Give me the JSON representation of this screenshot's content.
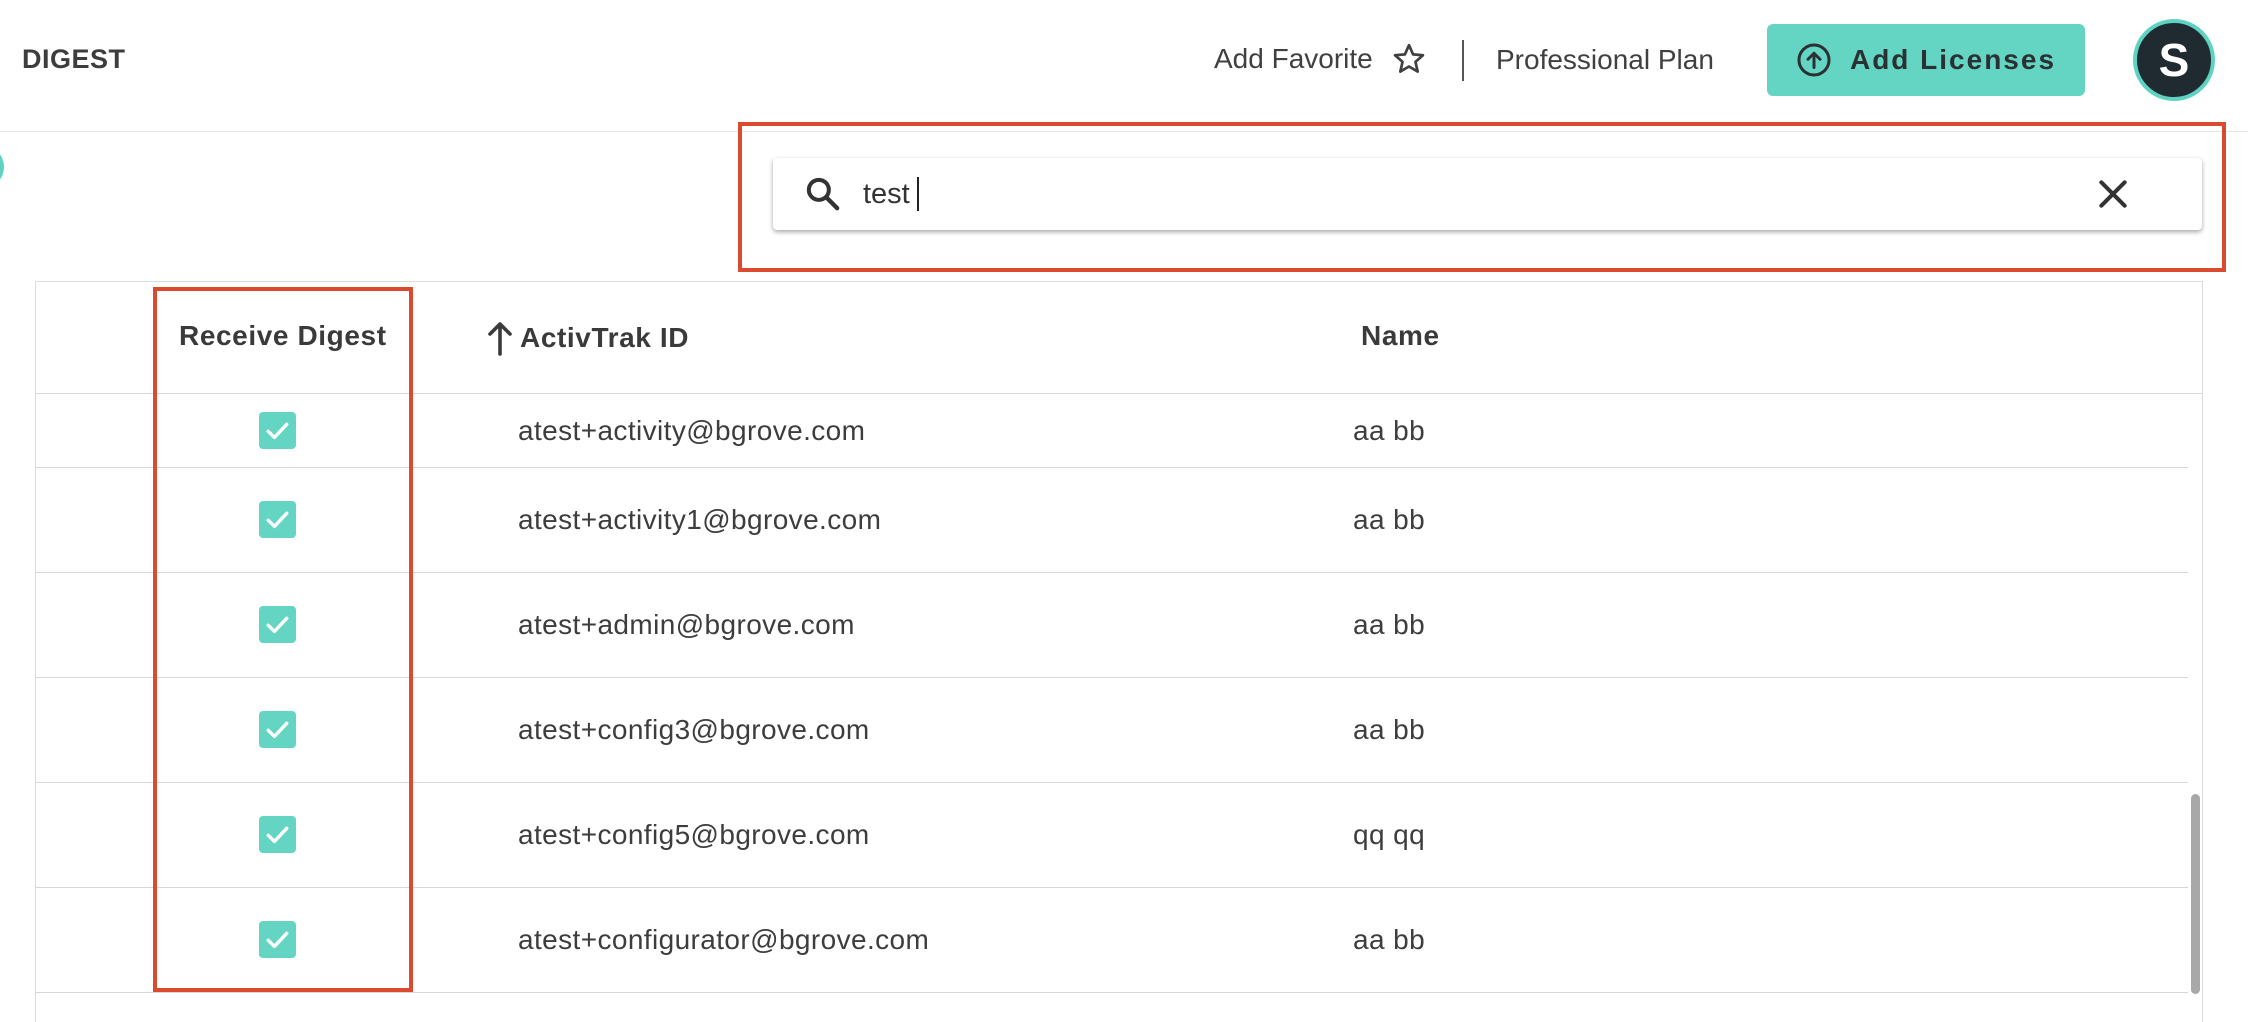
{
  "header": {
    "page_title": "DIGEST",
    "add_favorite_label": "Add Favorite",
    "plan_label": "Professional Plan",
    "add_licenses_label": "Add Licenses",
    "avatar_initial": "S"
  },
  "search": {
    "value": "test",
    "icon": "search-icon",
    "clear_icon": "close-icon"
  },
  "table": {
    "columns": [
      "Receive Digest",
      "ActivTrak ID",
      "Name"
    ],
    "sort_column": "ActivTrak ID",
    "sort_direction": "ascending",
    "rows": [
      {
        "receive_digest": true,
        "id": "atest+activity@bgrove.com",
        "name": "aa bb"
      },
      {
        "receive_digest": true,
        "id": "atest+activity1@bgrove.com",
        "name": "aa bb"
      },
      {
        "receive_digest": true,
        "id": "atest+admin@bgrove.com",
        "name": "aa bb"
      },
      {
        "receive_digest": true,
        "id": "atest+config3@bgrove.com",
        "name": "aa bb"
      },
      {
        "receive_digest": true,
        "id": "atest+config5@bgrove.com",
        "name": "qq qq"
      },
      {
        "receive_digest": true,
        "id": "atest+configurator@bgrove.com",
        "name": "aa bb"
      }
    ]
  },
  "colors": {
    "accent": "#64d5c3",
    "highlight": "#d94a30",
    "avatar_bg": "#1f2a31"
  }
}
